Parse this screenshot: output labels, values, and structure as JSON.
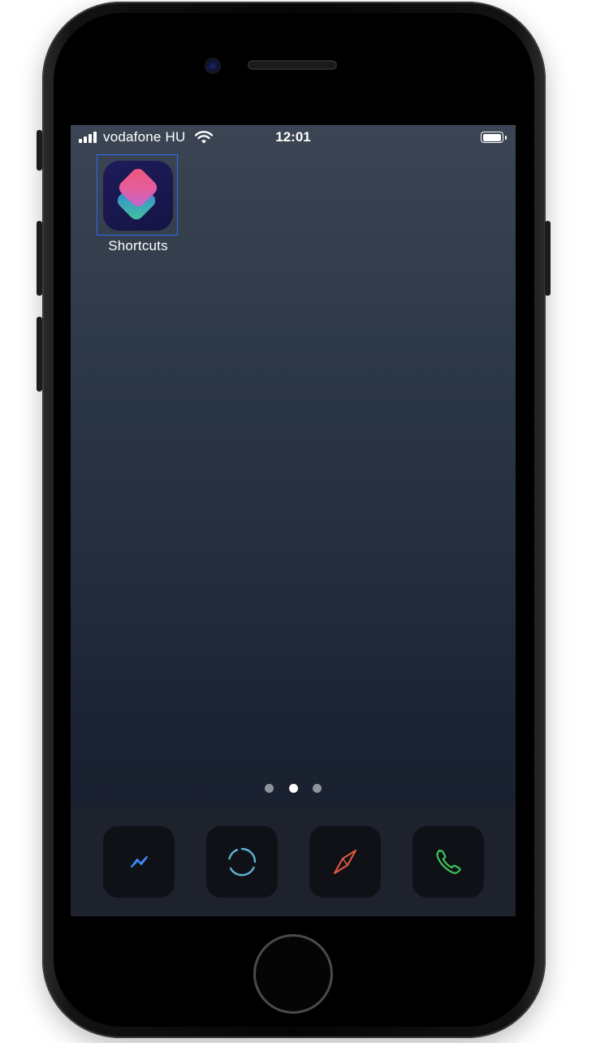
{
  "status_bar": {
    "carrier": "vodafone HU",
    "time": "12:01"
  },
  "home_screen": {
    "apps": [
      {
        "label": "Shortcuts",
        "icon": "shortcuts-icon",
        "focused": true
      }
    ],
    "page_indicator": {
      "pages": 3,
      "current_page": 2
    }
  },
  "dock": {
    "apps": [
      {
        "icon": "messenger-icon",
        "color": "#3a8cf5"
      },
      {
        "icon": "circle-ring-icon",
        "color": "#5fb3d6"
      },
      {
        "icon": "compass-icon",
        "color": "#e4593f"
      },
      {
        "icon": "phone-icon",
        "color": "#3ec45c"
      }
    ]
  },
  "colors": {
    "focus_outline": "#2f6bf0",
    "wallpaper_top": "#3b4553",
    "wallpaper_bottom": "#151b28",
    "dock_background": "#1d222d"
  }
}
